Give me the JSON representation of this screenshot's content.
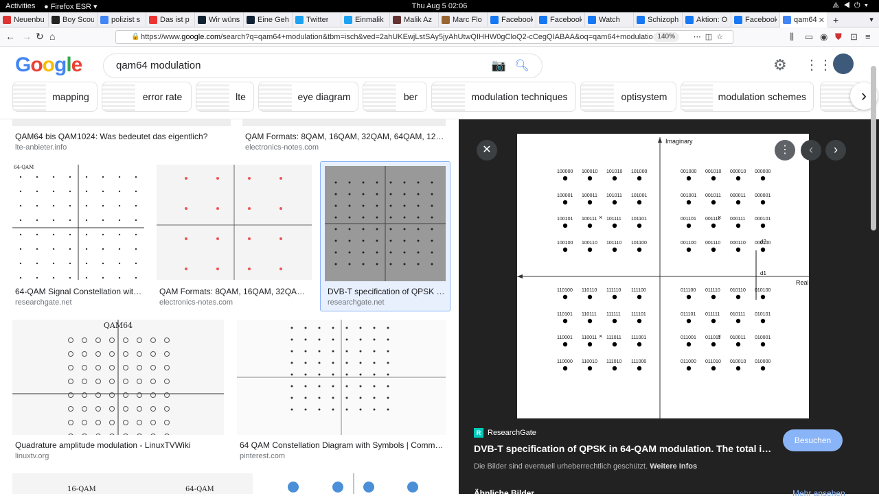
{
  "system": {
    "activities": "Activities",
    "browser": "Firefox ESR",
    "clock": "Thu Aug 5  02:06"
  },
  "tabs": [
    {
      "label": "Neuenbu",
      "color": "#d33"
    },
    {
      "label": "Boy Scou",
      "color": "#222"
    },
    {
      "label": "polizist s",
      "color": "#4285f4"
    },
    {
      "label": "Das ist p",
      "color": "#e33"
    },
    {
      "label": "Wir wüns",
      "color": "#123"
    },
    {
      "label": "Eine Geh",
      "color": "#123"
    },
    {
      "label": "Twitter",
      "color": "#1da1f2"
    },
    {
      "label": "Einmalik",
      "color": "#1da1f2"
    },
    {
      "label": "Malik Az",
      "color": "#633"
    },
    {
      "label": "Marc Flo",
      "color": "#963"
    },
    {
      "label": "Facebook",
      "color": "#1877f2"
    },
    {
      "label": "Facebook",
      "color": "#1877f2"
    },
    {
      "label": "Watch",
      "color": "#1877f2"
    },
    {
      "label": "Schizoph",
      "color": "#1877f2"
    },
    {
      "label": "Aktion: O",
      "color": "#1877f2"
    },
    {
      "label": "Facebook",
      "color": "#1877f2"
    },
    {
      "label": "qam64",
      "color": "#4285f4"
    }
  ],
  "nav": {
    "url_prefix": "https://www.",
    "url_domain": "google.com",
    "url_rest": "/search?q=qam64+modulation&tbm=isch&ved=2ahUKEwjLstSAy5jyAhUtwQIHHW0gCloQ2-cCegQIABAA&oq=qam64+modulation&gs...",
    "zoom": "140%"
  },
  "google": {
    "logo": "Google",
    "query": "qam64 modulation",
    "chips": [
      "mapping",
      "error rate",
      "lte",
      "eye diagram",
      "ber",
      "modulation techniques",
      "optisystem",
      "modulation schemes"
    ]
  },
  "results": [
    {
      "title": "QAM64 bis QAM1024: Was bedeutet das eigentlich?",
      "source": "lte-anbieter.info"
    },
    {
      "title": "QAM Formats: 8QAM, 16QAM, 32QAM, 64QAM, 128QA...",
      "source": "electronics-notes.com"
    },
    {
      "title": "64-QAM Signal Constellation with ...",
      "source": "researchgate.net",
      "img_caption": "64-QAM"
    },
    {
      "title": "QAM Formats: 8QAM, 16QAM, 32QAM, 6...",
      "source": "electronics-notes.com"
    },
    {
      "title": "DVB-T specification of QPSK in...",
      "source": "researchgate.net"
    },
    {
      "title": "Quadrature amplitude modulation - LinuxTVWiki",
      "source": "linuxtv.org",
      "img_caption": "QAM64"
    },
    {
      "title": "64 QAM Constellation Diagram with Symbols | Communi...",
      "source": "pinterest.com"
    },
    {
      "img_caption_a": "16-QAM",
      "img_caption_b": "64-QAM"
    }
  ],
  "preview": {
    "source": "ResearchGate",
    "title": "DVB-T specification of QPSK in 64-QAM modulation. The total infor...",
    "note": "Die Bilder sind eventuell urheberrechtlich geschützt.",
    "note_link": "Weitere Infos",
    "visit": "Besuchen",
    "similar": "Ähnliche Bilder",
    "more": "Mehr ansehen",
    "diagram": {
      "axis_y": "Imaginary",
      "axis_x": "Real",
      "d1": "d1",
      "d2": "d2",
      "quadrants": [
        [
          "100000",
          "100010",
          "101010",
          "101000",
          "100001",
          "100011",
          "101011",
          "101001",
          "100101",
          "100111",
          "101111",
          "101101",
          "100100",
          "100110",
          "101110",
          "101100"
        ],
        [
          "001000",
          "001010",
          "000010",
          "000000",
          "001001",
          "001011",
          "000011",
          "000001",
          "001101",
          "001111",
          "000111",
          "000101",
          "001100",
          "001110",
          "000110",
          "000100"
        ],
        [
          "110100",
          "110110",
          "111110",
          "111100",
          "110101",
          "110111",
          "111111",
          "111101",
          "110001",
          "110011",
          "111011",
          "111001",
          "110000",
          "110010",
          "111010",
          "111000"
        ],
        [
          "011100",
          "011110",
          "010110",
          "010100",
          "011101",
          "011111",
          "010111",
          "010101",
          "011001",
          "011011",
          "010011",
          "010001",
          "011000",
          "011010",
          "010010",
          "010000"
        ]
      ]
    }
  }
}
